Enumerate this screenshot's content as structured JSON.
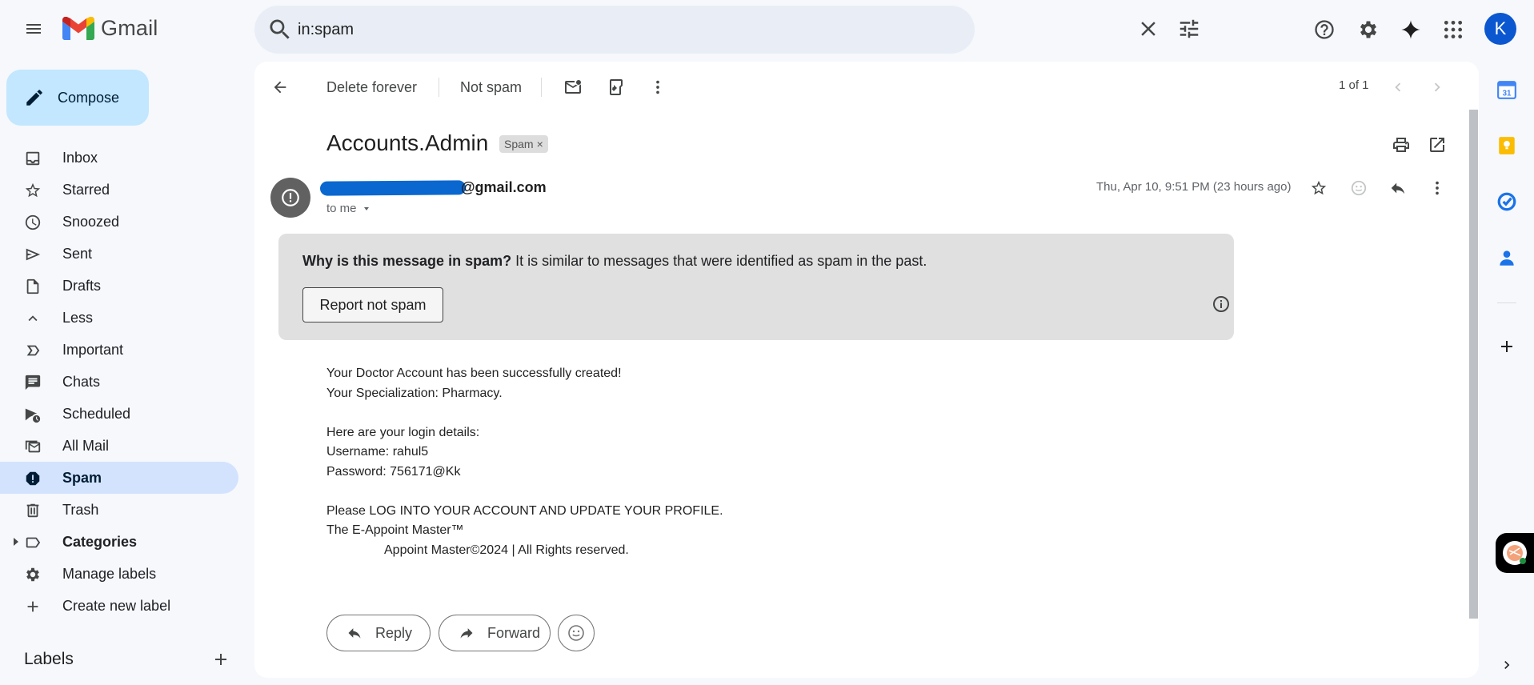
{
  "app": {
    "name": "Gmail",
    "avatar_letter": "K"
  },
  "search": {
    "query": "in:spam"
  },
  "compose": {
    "label": "Compose"
  },
  "sidebar": {
    "items": [
      {
        "label": "Inbox",
        "icon": "inbox-icon"
      },
      {
        "label": "Starred",
        "icon": "star-icon"
      },
      {
        "label": "Snoozed",
        "icon": "clock-icon"
      },
      {
        "label": "Sent",
        "icon": "send-icon"
      },
      {
        "label": "Drafts",
        "icon": "draft-icon"
      },
      {
        "label": "Less",
        "icon": "chevron-up-icon"
      },
      {
        "label": "Important",
        "icon": "important-icon"
      },
      {
        "label": "Chats",
        "icon": "chat-icon"
      },
      {
        "label": "Scheduled",
        "icon": "scheduled-icon"
      },
      {
        "label": "All Mail",
        "icon": "all-mail-icon"
      },
      {
        "label": "Spam",
        "icon": "spam-icon",
        "active": true
      },
      {
        "label": "Trash",
        "icon": "trash-icon"
      },
      {
        "label": "Categories",
        "icon": "label-icon"
      },
      {
        "label": "Manage labels",
        "icon": "gear-icon"
      },
      {
        "label": "Create new label",
        "icon": "plus-icon"
      }
    ],
    "labels_heading": "Labels"
  },
  "toolbar": {
    "delete_forever": "Delete forever",
    "not_spam": "Not spam",
    "pager": "1 of 1"
  },
  "message": {
    "subject": "Accounts.Admin",
    "spam_tag": "Spam",
    "sender_email_suffix": "@gmail.com",
    "to": "to me",
    "date": "Thu, Apr 10, 9:51 PM (23 hours ago)",
    "spam_question": "Why is this message in spam?",
    "spam_reason": " It is similar to messages that were identified as spam in the past.",
    "report_button": "Report not spam",
    "body": {
      "line1": "Your Doctor Account has been successfully created!",
      "line2": "Your Specialization: Pharmacy.",
      "line3": "Here are your login details:",
      "line4": "Username: rahul5",
      "line5": "Password: 756171@Kk",
      "line6": "Please LOG INTO YOUR ACCOUNT AND UPDATE YOUR PROFILE.",
      "line7": "The E-Appoint Master™",
      "line8": "Appoint Master©2024 | All Rights reserved."
    },
    "reply_label": "Reply",
    "forward_label": "Forward"
  },
  "colors": {
    "compose_bg": "#c2e7ff",
    "active_nav_bg": "#d3e3fd",
    "spam_banner_bg": "#e0e0e0",
    "avatar_bg": "#0b57d0"
  }
}
